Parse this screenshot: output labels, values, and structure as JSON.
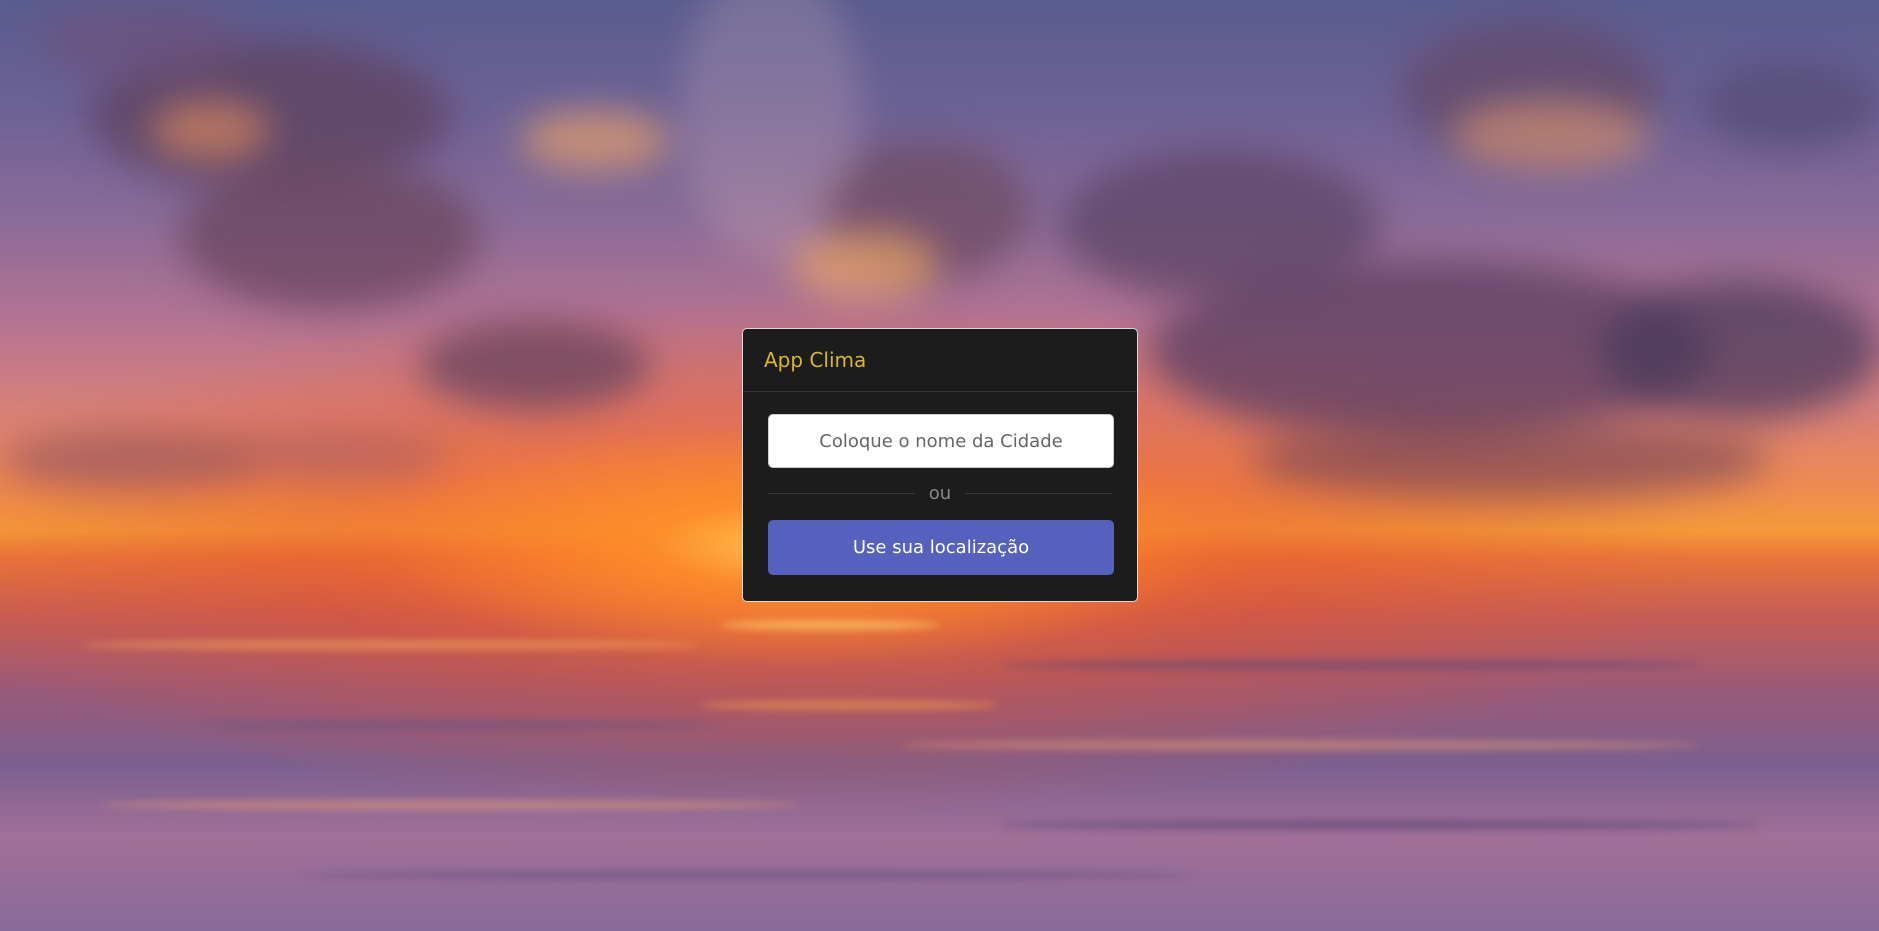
{
  "app": {
    "title": "App Clima"
  },
  "search": {
    "placeholder": "Coloque o nome da Cidade",
    "value": ""
  },
  "separator": {
    "label": "ou"
  },
  "location_button": {
    "label": "Use sua localização"
  },
  "background": {
    "description_icon": "sunset-over-water-image"
  },
  "colors": {
    "title": "#d9b81c",
    "card_bg": "#1c1c1c",
    "button_bg": "#5561bc",
    "button_text": "#ffffff"
  }
}
